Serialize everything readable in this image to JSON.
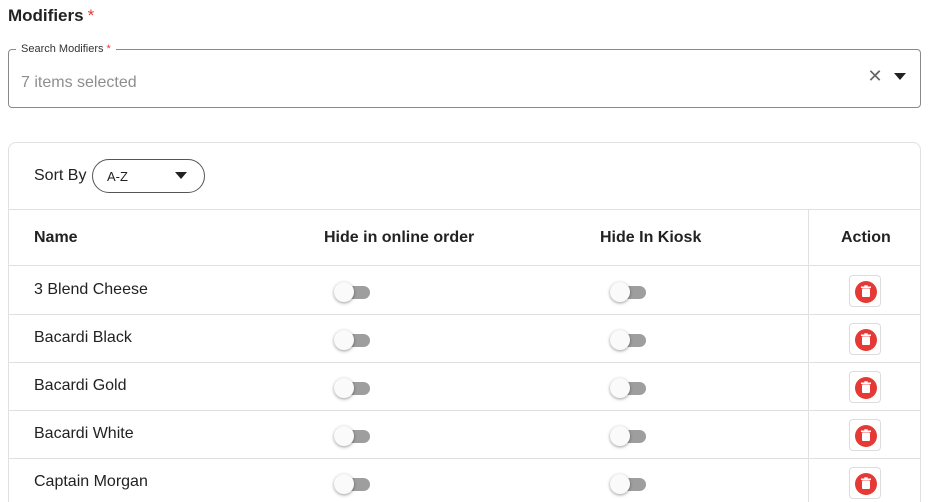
{
  "section": {
    "title": "Modifiers",
    "required_mark": "*"
  },
  "search": {
    "label": "Search Modifiers",
    "required_mark": "*",
    "value": "7 items selected",
    "clear_glyph": "✕",
    "clear_icon": "close-icon",
    "dropdown_icon": "caret-down-icon"
  },
  "sort": {
    "label": "Sort By",
    "selected": "A-Z"
  },
  "table": {
    "headers": {
      "name": "Name",
      "hide_online": "Hide in online order",
      "hide_kiosk": "Hide In Kiosk",
      "action": "Action"
    },
    "rows": [
      {
        "name": "3 Blend Cheese",
        "hide_online": false,
        "hide_kiosk": false
      },
      {
        "name": "Bacardi Black",
        "hide_online": false,
        "hide_kiosk": false
      },
      {
        "name": "Bacardi Gold",
        "hide_online": false,
        "hide_kiosk": false
      },
      {
        "name": "Bacardi White",
        "hide_online": false,
        "hide_kiosk": false
      },
      {
        "name": "Captain Morgan",
        "hide_online": false,
        "hide_kiosk": false
      }
    ]
  },
  "colors": {
    "required": "#e53935",
    "delete": "#e53935",
    "toggle_off_track": "#9e9e9e",
    "border": "#e0e0e0"
  }
}
